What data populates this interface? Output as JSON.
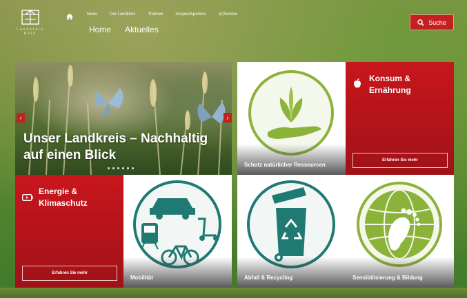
{
  "header": {
    "logo_text": "Landkreis Roth",
    "top_nav": [
      "News",
      "Der Landkreis",
      "Themen",
      "Ansprechpartner",
      "(e)Service"
    ],
    "sub_nav": [
      "Home",
      "Aktuelles"
    ],
    "search_label": "Suche"
  },
  "hero": {
    "title": "Unser Landkreis – Nachhaltig auf einen Blick",
    "prev_label": "‹",
    "next_label": "›",
    "dot_count": 6
  },
  "tiles": {
    "ressourcen": {
      "caption": "Schutz natürlicher Ressourcen"
    },
    "konsum": {
      "title": "Konsum & Ernährung",
      "button": "Erfahren Sie mehr"
    },
    "energie": {
      "title": "Energie & Klimaschutz",
      "button": "Erfahren Sie mehr"
    },
    "mobilitaet": {
      "caption": "Mobilität"
    },
    "abfall": {
      "caption": "Abfall & Recycling"
    },
    "bildung": {
      "caption": "Sensibilisierung & Bildung"
    }
  },
  "colors": {
    "accent_red": "#c51f1f",
    "green": "#8bb33a",
    "teal": "#1e7a72"
  },
  "icons": [
    "home-icon",
    "search-icon",
    "apple-icon",
    "battery-icon",
    "plant-hand-icon",
    "transport-icon",
    "recycling-bin-icon",
    "globe-footprint-icon"
  ]
}
